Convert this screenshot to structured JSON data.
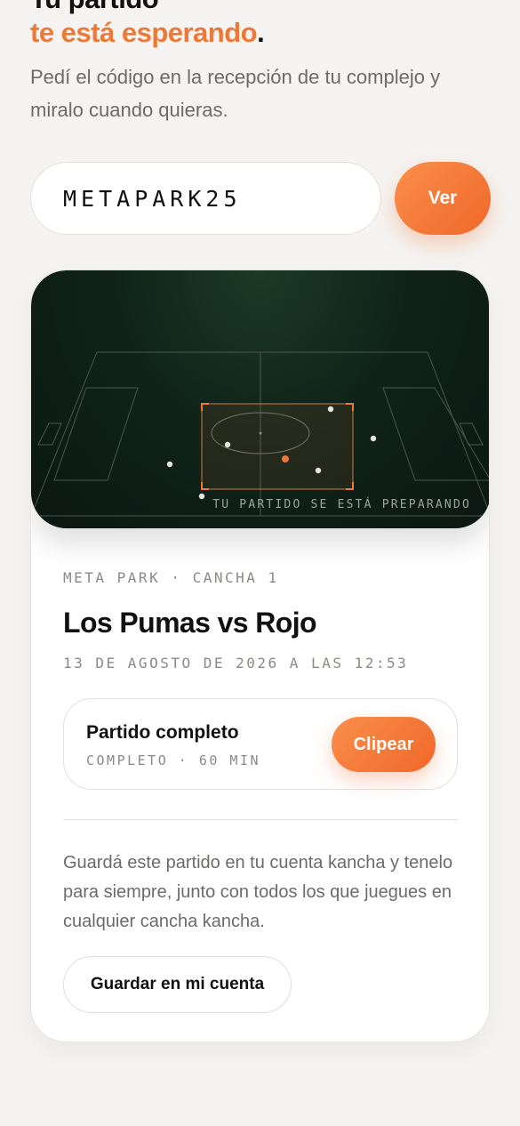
{
  "hero": {
    "title_line1": "Tu partido",
    "title_line2": "te está esperando",
    "title_dot": ".",
    "subtitle": "Pedí el código en la recepción de tu complejo y miralo cuando quieras."
  },
  "code_form": {
    "input_value": "METAPARK25",
    "button_label": "Ver"
  },
  "match": {
    "pitch_caption": "TU PARTIDO SE ESTÁ PREPARANDO",
    "venue": "META PARK · CANCHA 1",
    "title": "Los Pumas vs Rojo",
    "date": "13 DE AGOSTO DE 2026 A LAS 12:53",
    "clip": {
      "title": "Partido completo",
      "meta": "COMPLETO · 60 MIN",
      "button_label": "Clipear"
    },
    "save_description": "Guardá este partido en tu cuenta kancha y tenelo para siempre, junto con todos los que juegues en cualquier cancha kancha.",
    "save_button_label": "Guardar en mi cuenta"
  },
  "colors": {
    "accent": "#f07836",
    "background": "#f5f4f2",
    "pitch_dark": "#0b1712"
  }
}
